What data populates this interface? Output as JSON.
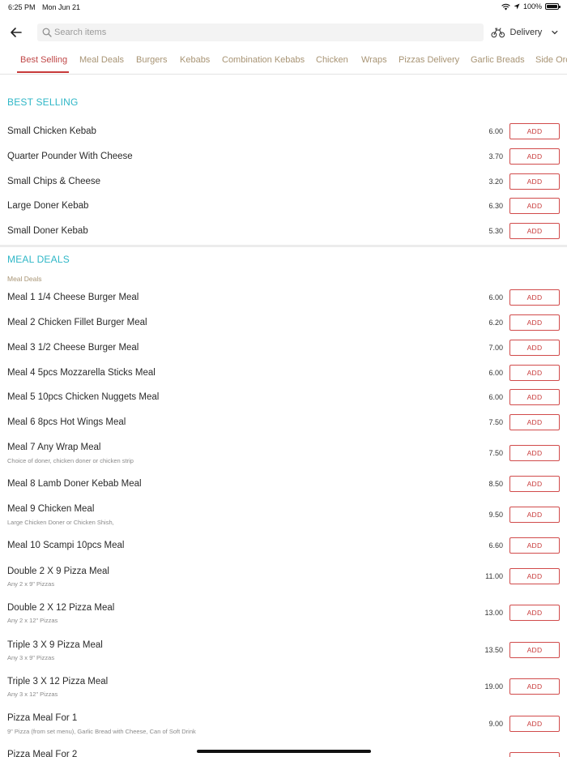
{
  "status_bar": {
    "time": "6:25 PM",
    "date": "Mon Jun 21",
    "battery": "100%"
  },
  "search": {
    "placeholder": "Search items"
  },
  "delivery": {
    "label": "Delivery"
  },
  "tabs": [
    {
      "label": "Best Selling",
      "active": true
    },
    {
      "label": "Meal Deals"
    },
    {
      "label": "Burgers"
    },
    {
      "label": "Kebabs"
    },
    {
      "label": "Combination Kebabs"
    },
    {
      "label": "Chicken"
    },
    {
      "label": "Wraps"
    },
    {
      "label": "Pizzas Delivery"
    },
    {
      "label": "Garlic Breads"
    },
    {
      "label": "Side Orc"
    }
  ],
  "add_label": "ADD",
  "sections": [
    {
      "title": "BEST SELLING",
      "items": [
        {
          "name": "Small Chicken Kebab",
          "price": "6.00"
        },
        {
          "name": "Quarter Pounder With Cheese",
          "price": "3.70"
        },
        {
          "name": "Small Chips & Cheese",
          "price": "3.20"
        },
        {
          "name": "Large Doner Kebab",
          "price": "6.30"
        },
        {
          "name": "Small Doner Kebab",
          "price": "5.30"
        }
      ]
    },
    {
      "title": "MEAL DEALS",
      "subtitle": "Meal Deals",
      "items": [
        {
          "name": "Meal 1 1/4 Cheese Burger Meal",
          "price": "6.00"
        },
        {
          "name": "Meal 2 Chicken Fillet Burger Meal",
          "price": "6.20"
        },
        {
          "name": "Meal 3 1/2 Cheese Burger Meal",
          "price": "7.00"
        },
        {
          "name": "Meal 4 5pcs Mozzarella Sticks Meal",
          "price": "6.00"
        },
        {
          "name": "Meal 5 10pcs Chicken Nuggets Meal",
          "price": "6.00"
        },
        {
          "name": "Meal 6 8pcs Hot Wings Meal",
          "price": "7.50"
        },
        {
          "name": "Meal 7 Any Wrap Meal",
          "desc": "Choice of doner, chicken doner or chicken strip",
          "price": "7.50"
        },
        {
          "name": "Meal 8 Lamb Doner Kebab Meal",
          "price": "8.50"
        },
        {
          "name": "Meal 9 Chicken Meal",
          "desc": "Large Chicken Doner or Chicken Shish,",
          "price": "9.50"
        },
        {
          "name": "Meal 10 Scampi 10pcs Meal",
          "price": "6.60"
        },
        {
          "name": "Double 2 X 9 Pizza Meal",
          "desc": "Any 2 x 9\" Pizzas",
          "price": "11.00"
        },
        {
          "name": "Double 2 X 12 Pizza Meal",
          "desc": "Any 2 x 12\" Pizzas",
          "price": "13.00"
        },
        {
          "name": "Triple 3 X 9 Pizza Meal",
          "desc": "Any 3 x 9\" Pizzas",
          "price": "13.50"
        },
        {
          "name": "Triple 3 X 12 Pizza Meal",
          "desc": "Any 3 x 12\" Pizzas",
          "price": "19.00"
        },
        {
          "name": "Pizza Meal For 1",
          "desc": "9\" Pizza (from set menu), Garlic Bread with Cheese, Can of Soft Drink",
          "price": "9.00"
        },
        {
          "name": "Pizza Meal For 2",
          "price": ""
        }
      ]
    }
  ]
}
